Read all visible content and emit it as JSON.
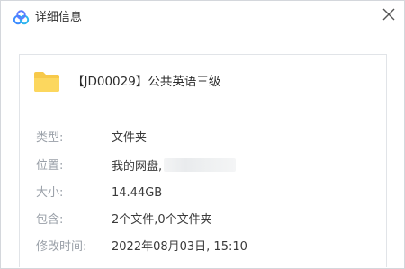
{
  "dialog": {
    "title": "详细信息",
    "logo_icon": "cloud-link-logo",
    "close_icon": "close-icon"
  },
  "file": {
    "icon": "folder-icon",
    "name": "【JD00029】公共英语三级"
  },
  "details": [
    {
      "label": "类型:",
      "value": "文件夹"
    },
    {
      "label": "位置:",
      "value": "我的网盘,"
    },
    {
      "label": "大小:",
      "value": "14.44GB"
    },
    {
      "label": "包含:",
      "value": "2个文件,0个文件夹"
    },
    {
      "label": "修改时间:",
      "value": "2022年08月03日, 15:10"
    }
  ],
  "colors": {
    "accent": "#3b8cff",
    "folder": "#f7c94a",
    "divider": "#b9dde0",
    "label": "#9aa0a8"
  }
}
